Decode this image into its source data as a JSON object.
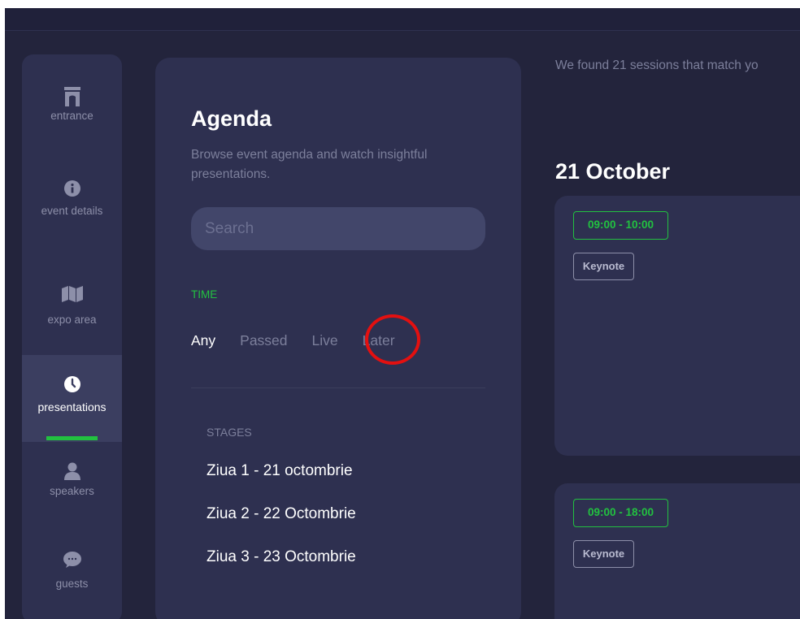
{
  "nav": {
    "items": [
      {
        "label": "entrance",
        "icon": "gate-icon"
      },
      {
        "label": "event details",
        "icon": "info-icon"
      },
      {
        "label": "expo area",
        "icon": "map-icon"
      },
      {
        "label": "presentations",
        "icon": "clock-icon"
      },
      {
        "label": "speakers",
        "icon": "user-icon"
      },
      {
        "label": "guests",
        "icon": "chat-icon"
      }
    ],
    "active": "presentations",
    "active_color": "#22c140"
  },
  "agenda": {
    "title": "Agenda",
    "subtitle": "Browse event agenda and watch insightful presentations.",
    "search_placeholder": "Search",
    "time_label": "TIME",
    "time_filters": [
      "Any",
      "Passed",
      "Live",
      "Later"
    ],
    "selected_time_filter": "Any",
    "stages_label": "STAGES",
    "stages": [
      "Ziua 1 - 21 octombrie",
      "Ziua 2 - 22 Octombrie",
      "Ziua 3 - 23 Octombrie"
    ]
  },
  "results": {
    "found_text": "We found 21 sessions that match yo",
    "date_heading": "21 October",
    "sessions": [
      {
        "time": "09:00 - 10:00",
        "tag": "Keynote"
      },
      {
        "time": "09:00 - 18:00",
        "tag": "Keynote"
      }
    ]
  },
  "annotation": {
    "circled_item": "Later",
    "color": "#e31010"
  },
  "colors": {
    "background": "#23243c",
    "panel": "#2e3050",
    "accent": "#22c140"
  }
}
